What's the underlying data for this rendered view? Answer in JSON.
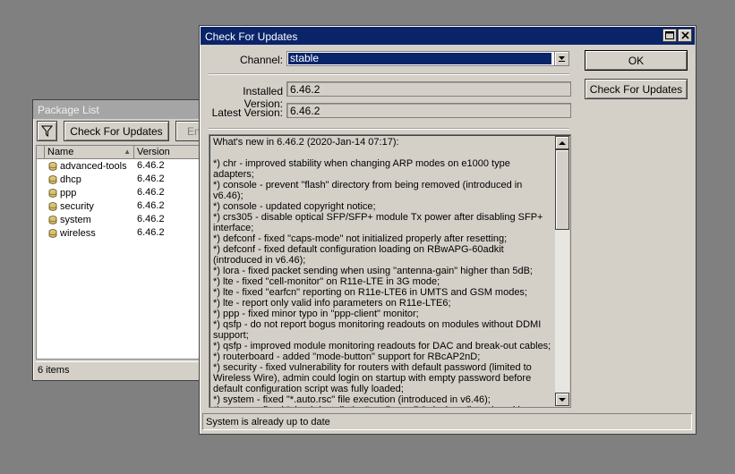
{
  "package_list": {
    "title": "Package List",
    "check_button": "Check For Updates",
    "enable_button_partial": "En",
    "columns": {
      "name": "Name",
      "version": "Version"
    },
    "rows": [
      {
        "name": "advanced-tools",
        "version": "6.46.2"
      },
      {
        "name": "dhcp",
        "version": "6.46.2"
      },
      {
        "name": "ppp",
        "version": "6.46.2"
      },
      {
        "name": "security",
        "version": "6.46.2"
      },
      {
        "name": "system",
        "version": "6.46.2"
      },
      {
        "name": "wireless",
        "version": "6.46.2"
      }
    ],
    "status": "6 items"
  },
  "check_updates": {
    "title": "Check For Updates",
    "channel_label": "Channel:",
    "channel_value": "stable",
    "installed_label": "Installed Version:",
    "installed_value": "6.46.2",
    "latest_label": "Latest Version:",
    "latest_value": "6.46.2",
    "ok_button": "OK",
    "check_button": "Check For Updates",
    "status": "System is already up to date",
    "notes": "What's new in 6.46.2 (2020-Jan-14 07:17):\n\n*) chr - improved stability when changing ARP modes on e1000 type adapters;\n*) console - prevent \"flash\" directory from being removed (introduced in v6.46);\n*) console - updated copyright notice;\n*) crs305 - disable optical SFP/SFP+ module Tx power after disabling SFP+ interface;\n*) defconf - fixed \"caps-mode\" not initialized properly after resetting;\n*) defconf - fixed default configuration loading on RBwAPG-60adkit (introduced in v6.46);\n*) lora - fixed packet sending when using \"antenna-gain\" higher than 5dB;\n*) lte - fixed \"cell-monitor\" on R11e-LTE in 3G mode;\n*) lte - fixed \"earfcn\" reporting on R11e-LTE6 in UMTS and GSM modes;\n*) lte - report only valid info parameters on R11e-LTE6;\n*) ppp - fixed minor typo in \"ppp-client\" monitor;\n*) qsfp - do not report bogus monitoring readouts on modules without DDMI support;\n*) qsfp - improved module monitoring readouts for DAC and break-out cables;\n*) routerboard - added \"mode-button\" support for RBcAP2nD;\n*) security - fixed vulnerability for routers with default password (limited to Wireless Wire), admin could login on startup with empty password before default configuration script was fully loaded;\n*) system - fixed \"*.auto.rsc\" file execution (introduced in v6.46);\n*) system - fixed \"check-installation\" on PowerPC devices (introduced in"
  },
  "icons": {
    "filter": "filter-icon",
    "package": "package-icon",
    "maximize": "maximize-icon",
    "close": "close-icon",
    "dropdown": "chevron-down-icon",
    "scroll_up": "scroll-up-icon",
    "scroll_down": "scroll-down-icon"
  },
  "colors": {
    "desktop": "#808080",
    "window": "#d4d0c8",
    "active_title": "#0a246a",
    "inactive_title": "#a5a5a5"
  }
}
